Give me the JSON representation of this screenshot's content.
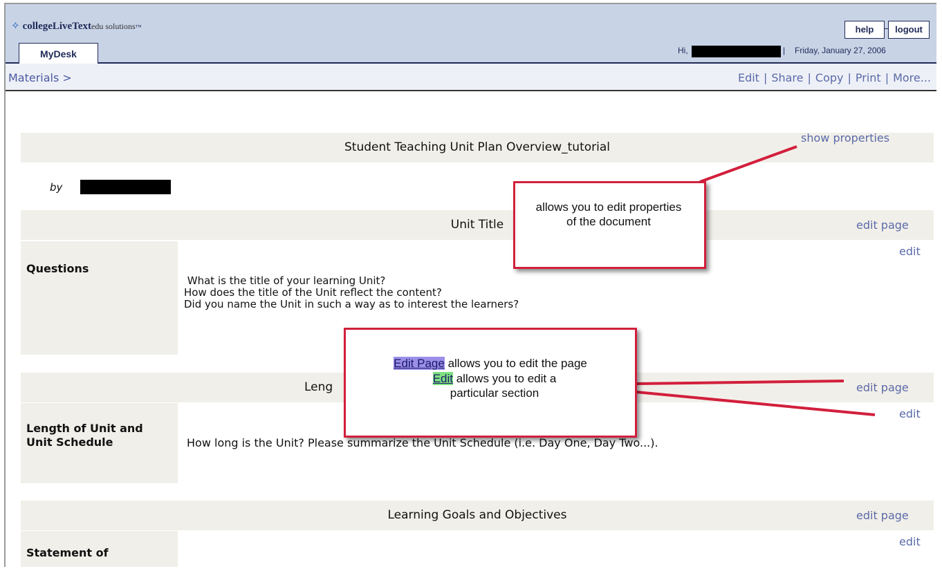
{
  "header": {
    "logo_brand": "collegeLiveText",
    "logo_sub": "edu solutions",
    "help_label": "help",
    "logout_label": "logout",
    "tab_label": "MyDesk",
    "greeting": "Hi,",
    "date_sep": "|",
    "date": "Friday, January 27, 2006"
  },
  "subbar": {
    "breadcrumb": "Materials >",
    "actions": [
      "Edit",
      "Share",
      "Copy",
      "Print",
      "More..."
    ],
    "separator": "|"
  },
  "document": {
    "title": "Student Teaching Unit Plan Overview_tutorial",
    "show_properties": "show properties",
    "by": "by",
    "sections": [
      {
        "title": "Unit Title",
        "edit_page": "edit page",
        "edit": "edit",
        "label": "Questions",
        "text": " What is the title of your learning Unit?\nHow does the title of the Unit reflect the content?\nDid you name the Unit in such a way as to interest the learners?"
      },
      {
        "title": "Leng",
        "edit_page": "edit page",
        "edit": "edit",
        "label": "Length of Unit and\nUnit Schedule",
        "text": "How long is the Unit? Please summarize the Unit Schedule (i.e. Day One, Day Two...)."
      },
      {
        "title": "Learning Goals and Objectives",
        "edit_page": "edit page",
        "edit": "edit",
        "label": "Statement of"
      }
    ]
  },
  "annotations": {
    "callout1": "allows you to edit properties of the document",
    "callout2_a_hl": "Edit Page",
    "callout2_a_rest": " allows you to edit the page",
    "callout2_b_hl": "Edit",
    "callout2_b_rest": " allows you to edit a particular section",
    "color_border": "#d21f3c",
    "color_edit_page_highlight": "#9b8ee8",
    "color_edit_highlight": "#7fe07f"
  },
  "colors": {
    "topbar": "#c8d3e6",
    "subbar": "#eef0f7",
    "band": "#f1efe9",
    "link": "#5a6aa8",
    "navy": "#1f2a57"
  }
}
